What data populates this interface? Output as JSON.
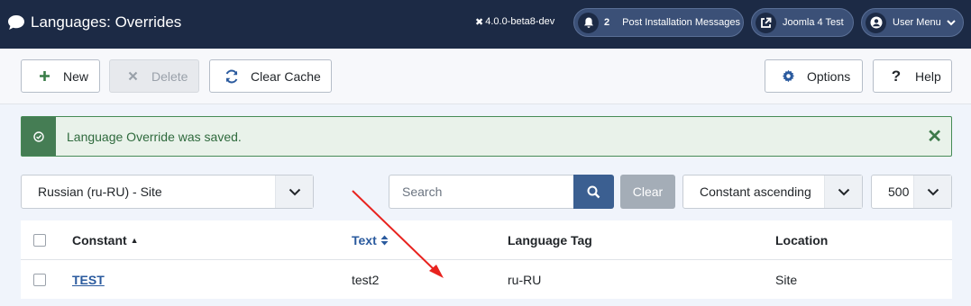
{
  "header": {
    "title": "Languages: Overrides",
    "version": "4.0.0-beta8-dev",
    "post_install": {
      "count": "2",
      "label": "Post Installation Messages"
    },
    "site_link": "Joomla 4 Test",
    "user_menu": "User Menu"
  },
  "toolbar": {
    "new_label": "New",
    "delete_label": "Delete",
    "clear_cache_label": "Clear Cache",
    "options_label": "Options",
    "help_label": "Help"
  },
  "alert": {
    "message": "Language Override was saved.",
    "close_glyph": "✕"
  },
  "filters": {
    "language": "Russian (ru-RU) - Site",
    "search_placeholder": "Search",
    "clear_label": "Clear",
    "ordering": "Constant ascending",
    "limit": "500"
  },
  "table": {
    "columns": {
      "constant": "Constant",
      "text": "Text",
      "language_tag": "Language Tag",
      "location": "Location"
    },
    "rows": [
      {
        "constant": "TEST",
        "text": "test2",
        "language_tag": "ru-RU",
        "location": "Site"
      }
    ]
  },
  "colors": {
    "header_bg": "#1c2a45",
    "accent": "#3b5f91",
    "success": "#457d54",
    "annotation_arrow": "#e8231f"
  }
}
